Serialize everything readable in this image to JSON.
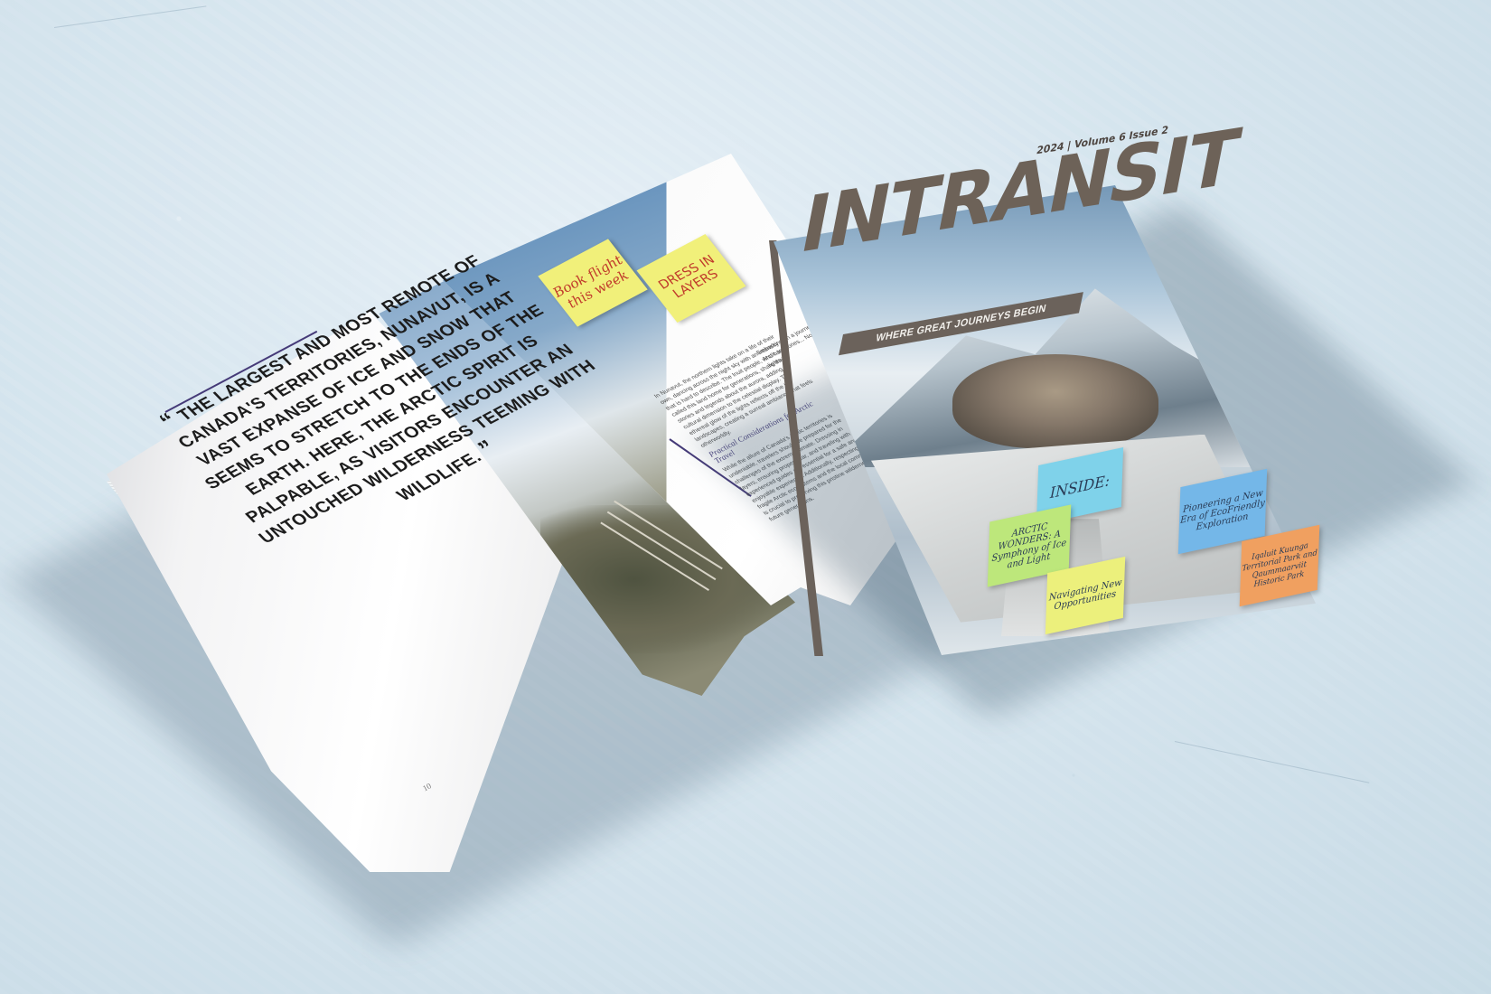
{
  "scene": {
    "description_hidden": "",
    "background_color": "#d7e6ef"
  },
  "magazine_spread": {
    "quote": {
      "open_mark": "“",
      "text": "THE LARGEST AND MOST REMOTE OF CANADA'S TERRITORIES, NUNAVUT, IS A VAST EXPANSE OF ICE AND SNOW THAT SEEMS TO STRETCH TO THE ENDS OF THE EARTH. HERE, THE ARCTIC SPIRIT IS PALPABLE, AS VISITORS ENCOUNTER AN UNTOUCHED WILDERNESS TEEMING WITH WILDLIFE.",
      "close_mark": "”"
    },
    "page_number": "10",
    "body_column_1": "In Nunavut, the northern lights take on a life of their own, dancing across the night sky with an intensity that is hard to describe. The Inuit people, who have called this land home for generations, share their stories and legends about the aurora, adding a cultural dimension to the celestial display. The ethereal glow of the lights reflects off the icy landscapes, creating a surreal ambiance that feels otherworldly.",
    "subhead": "Practical Considerations for Arctic Travel",
    "body_column_2": "While the allure of Canada's Arctic territories is undeniable, travelers should be prepared for the challenges of the extreme climate. Dressing in layers, ensuring proper gear, and traveling with experienced guides are essential for a safe and enjoyable experience. Additionally, respecting the fragile Arctic ecosystems and the local communities is crucial to preserving this pristine wilderness for future generations.",
    "body_column_3": "Embarking on a journey to the Arctic territories... Northern lights...",
    "sticky_notes": [
      {
        "text": "Book flight this week",
        "color": "#f1f07a",
        "ink": "#c0392b"
      },
      {
        "text": "DRESS IN LAYERS",
        "color": "#f1f07a",
        "ink": "#c0392b"
      }
    ]
  },
  "cover": {
    "title": "INTRANSIT",
    "issue": "2024 | Volume 6 Issue 2",
    "tagline": "WHERE GREAT JOURNEYS BEGIN",
    "apple_logo": "",
    "sticky_notes": [
      {
        "text": "INSIDE:",
        "color": "#7fd2ea"
      },
      {
        "text": "ARCTIC WONDERS: A Symphony of Ice and Light",
        "color": "#bde77b"
      },
      {
        "text": "Pioneering a New Era of EcoFriendly Exploration",
        "color": "#74b7e8"
      },
      {
        "text": "Navigating New Opportunities",
        "color": "#ecf07c"
      },
      {
        "text": "Iqaluit Kuunga Territorial Park and Qaummaarviit Historic Park",
        "color": "#f0a060"
      }
    ]
  }
}
